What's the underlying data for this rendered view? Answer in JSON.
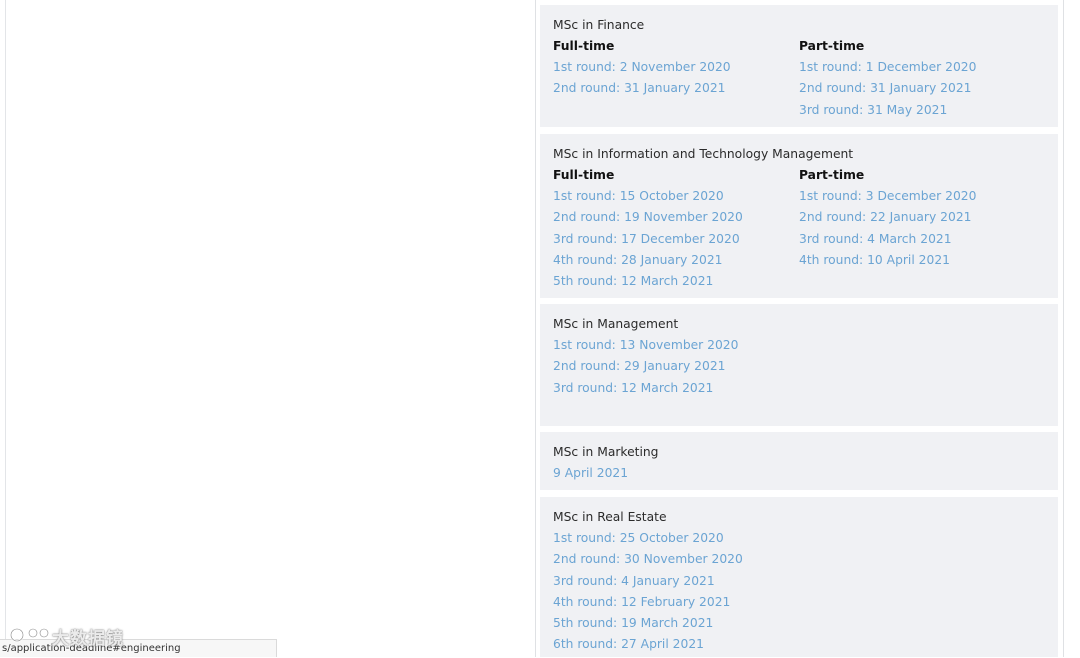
{
  "programs": [
    {
      "title": "MSc in Finance",
      "columns": [
        {
          "heading": "Full-time",
          "rounds": [
            "1st round: 2 November 2020",
            "2nd round: 31 January 2021"
          ]
        },
        {
          "heading": "Part-time",
          "rounds": [
            "1st round: 1 December 2020",
            "2nd round: 31 January 2021",
            "3rd round: 31 May 2021"
          ]
        }
      ]
    },
    {
      "title": "MSc in Information and Technology Management",
      "columns": [
        {
          "heading": "Full-time",
          "rounds": [
            "1st round: 15 October 2020",
            "2nd round: 19 November 2020",
            "3rd round: 17 December 2020",
            "4th round: 28 January 2021",
            "5th round: 12 March 2021"
          ]
        },
        {
          "heading": "Part-time",
          "rounds": [
            "1st round: 3 December 2020",
            "2nd round: 22 January 2021",
            "3rd round: 4 March 2021",
            "4th round: 10 April 2021"
          ]
        }
      ]
    },
    {
      "title": "MSc in Management",
      "rounds": [
        "1st round: 13 November 2020",
        "2nd round: 29 January 2021",
        "3rd round: 12 March 2021"
      ]
    },
    {
      "title": "MSc in Marketing",
      "rounds": [
        "9 April 2021"
      ]
    },
    {
      "title": "MSc in Real Estate",
      "rounds": [
        "1st round: 25 October 2020",
        "2nd round: 30 November 2020",
        "3rd round: 4 January 2021",
        "4th round: 12 February 2021",
        "5th round: 19 March 2021",
        "6th round: 27 April 2021"
      ]
    }
  ],
  "status_url": "s/application-deadline#engineering",
  "watermark_text": "大数据镜",
  "colors": {
    "link": "#6ba4d3",
    "card_bg": "#f0f1f4",
    "heading": "#111111"
  }
}
